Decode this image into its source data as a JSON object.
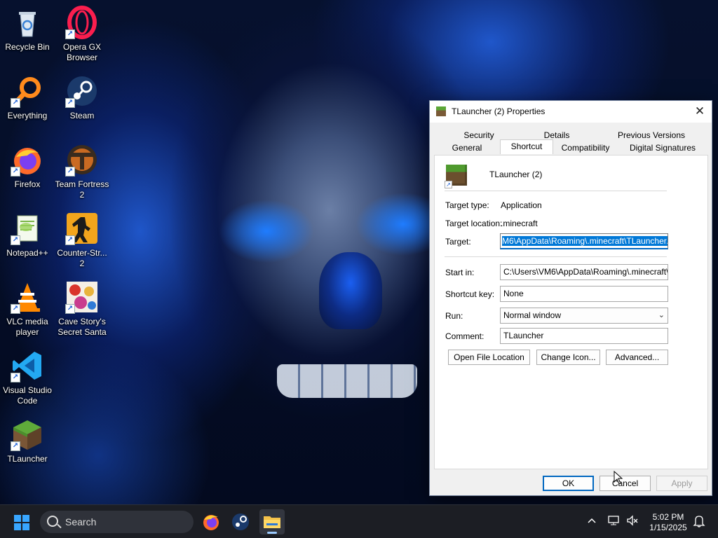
{
  "desktop": {
    "icons": [
      {
        "label": "Recycle Bin",
        "icon": "recycle-bin-icon"
      },
      {
        "label": "Opera GX Browser",
        "icon": "opera-gx-icon"
      },
      {
        "label": "Everything",
        "icon": "everything-search-icon"
      },
      {
        "label": "Steam",
        "icon": "steam-icon"
      },
      {
        "label": "Firefox",
        "icon": "firefox-icon"
      },
      {
        "label": "Team Fortress 2",
        "icon": "team-fortress-icon"
      },
      {
        "label": "Notepad++",
        "icon": "notepadpp-icon"
      },
      {
        "label": "Counter-Str... 2",
        "icon": "counter-strike-icon"
      },
      {
        "label": "VLC media player",
        "icon": "vlc-icon"
      },
      {
        "label": "Cave Story's Secret Santa",
        "icon": "cave-story-icon"
      },
      {
        "label": "Visual Studio Code",
        "icon": "vscode-icon"
      },
      {
        "label": "TLauncher",
        "icon": "minecraft-icon"
      }
    ]
  },
  "dialog": {
    "title": "TLauncher (2) Properties",
    "close_glyph": "✕",
    "tabs_row1": [
      "Security",
      "Details",
      "Previous Versions"
    ],
    "tabs_row2": [
      "General",
      "Shortcut",
      "Compatibility",
      "Digital Signatures"
    ],
    "active_tab": "Shortcut",
    "shortcut_name": "TLauncher (2)",
    "target_type_label": "Target type:",
    "target_type_value": "Application",
    "target_location_label": "Target location:",
    "target_location_value": ".minecraft",
    "target_label": "Target:",
    "target_value": "M6\\AppData\\Roaming\\.minecraft\\TLauncher.exe",
    "start_in_label": "Start in:",
    "start_in_value": "C:\\Users\\VM6\\AppData\\Roaming\\.minecraft\\",
    "shortcut_key_label": "Shortcut key:",
    "shortcut_key_value": "None",
    "run_label": "Run:",
    "run_value": "Normal window",
    "comment_label": "Comment:",
    "comment_value": "TLauncher",
    "buttons": {
      "open_file_location": "Open File Location",
      "change_icon": "Change Icon...",
      "advanced": "Advanced...",
      "ok": "OK",
      "cancel": "Cancel",
      "apply": "Apply"
    }
  },
  "taskbar": {
    "search_placeholder": "Search",
    "apps": [
      "firefox-icon",
      "steam-icon",
      "file-explorer-icon"
    ],
    "time": "5:02 PM",
    "date": "1/15/2025"
  },
  "colors": {
    "accent": "#0067c0",
    "selection": "#0078d7",
    "taskbar": "#1c1e24"
  }
}
